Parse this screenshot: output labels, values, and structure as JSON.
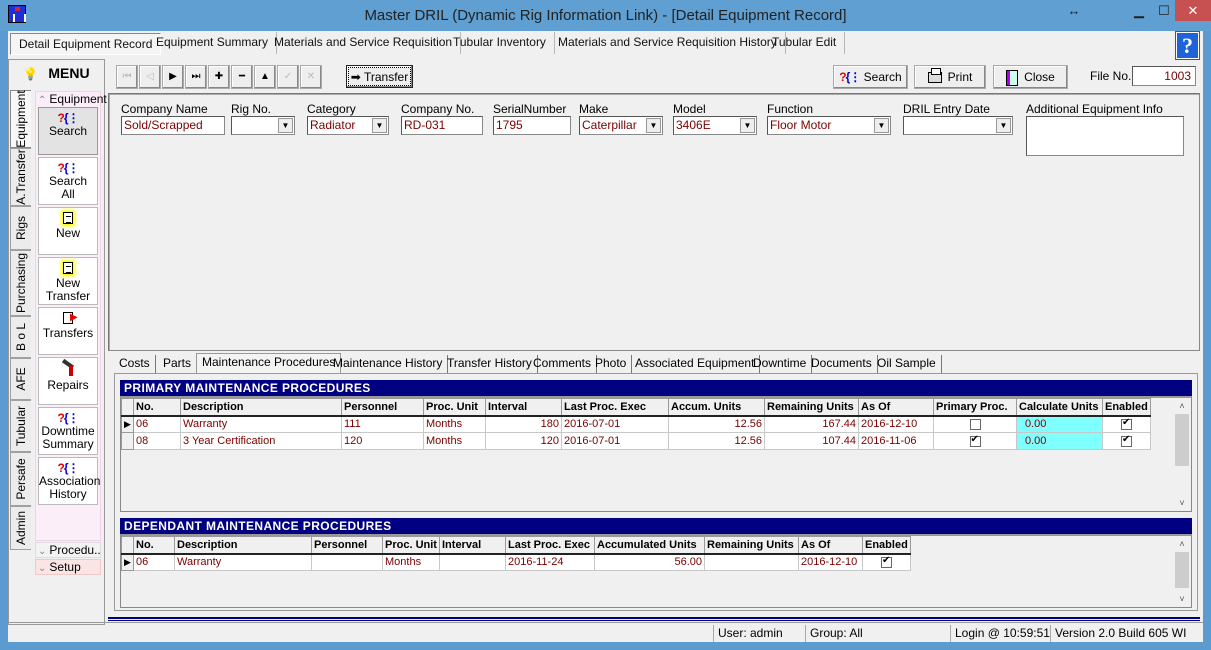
{
  "window": {
    "title": "Master DRIL (Dynamic Rig Information Link) - [Detail Equipment Record]",
    "resize_indicator": "↔",
    "minimize": "▁",
    "maximize": "☐",
    "close": "✕"
  },
  "main_tabs": [
    {
      "label": "Detail Equipment Record",
      "active": true
    },
    {
      "label": "Equipment Summary"
    },
    {
      "label": "Materials and Service Requisition"
    },
    {
      "label": "Tubular Inventory"
    },
    {
      "label": "Materials and Service Requisition History"
    },
    {
      "label": "Tubular Edit"
    }
  ],
  "help_label": "?",
  "menu": {
    "title": "MENU",
    "vertical_tabs": [
      "Equipment",
      "A.Transfer",
      "Rigs",
      "Purchasing",
      "B o L",
      "AFE",
      "Tubular",
      "Persafe",
      "Admin"
    ],
    "group_header": "Equipment",
    "items": [
      {
        "label_1": "Search",
        "label_2": "",
        "icon": "search-icon"
      },
      {
        "label_1": "Search",
        "label_2": "All",
        "icon": "search-icon"
      },
      {
        "label_1": "New",
        "label_2": "",
        "icon": "new-document-icon"
      },
      {
        "label_1": "New",
        "label_2": "Transfer",
        "icon": "new-document-icon"
      },
      {
        "label_1": "Transfers",
        "label_2": "",
        "icon": "transfer-document-icon"
      },
      {
        "label_1": "Repairs",
        "label_2": "",
        "icon": "repair-tools-icon"
      },
      {
        "label_1": "Downtime",
        "label_2": "Summary",
        "icon": "search-icon"
      },
      {
        "label_1": "Association",
        "label_2": "History",
        "icon": "search-icon"
      }
    ],
    "collapsed_groups": [
      "Procedu...",
      "Setup"
    ]
  },
  "toolbar": {
    "nav": {
      "first": "⏮",
      "prev": "◁",
      "next": "▶",
      "last": "⏭",
      "add": "✚",
      "delete": "━",
      "up": "▲",
      "confirm": "✓",
      "cancel": "✕"
    },
    "transfer_label": "Transfer",
    "transfer_icon": "➡",
    "search_label": "Search",
    "print_label": "Print",
    "close_label": "Close",
    "file_no_label": "File No.",
    "file_no_value": "1003"
  },
  "header_fields": [
    {
      "label": "Company Name",
      "value": "Sold/Scrapped",
      "dropdown": false
    },
    {
      "label": "Rig No.",
      "value": "",
      "dropdown": true
    },
    {
      "label": "Category",
      "value": "Radiator",
      "dropdown": true
    },
    {
      "label": "Company No.",
      "value": "RD-031",
      "dropdown": false
    },
    {
      "label": "SerialNumber",
      "value": "1795",
      "dropdown": false
    },
    {
      "label": "Make",
      "value": "Caterpillar",
      "dropdown": true
    },
    {
      "label": "Model",
      "value": "3406E",
      "dropdown": true
    },
    {
      "label": "Function",
      "value": "Floor Motor",
      "dropdown": true
    },
    {
      "label": "DRIL Entry Date",
      "value": "",
      "dropdown": true
    },
    {
      "label": "Additional Equipment Info",
      "value": ""
    }
  ],
  "sub_tabs": [
    "Costs",
    "Parts",
    "Maintenance Procedures",
    "Maintenance History",
    "Transfer History",
    "Comments",
    "Photo",
    "Associated Equipment",
    "Downtime",
    "Documents",
    "Oil Sample"
  ],
  "active_sub_tab": "Maintenance Procedures",
  "primary": {
    "title": "PRIMARY MAINTENANCE PROCEDURES",
    "columns": [
      "No.",
      "Description",
      "Personnel",
      "Proc. Unit",
      "Interval",
      "Last Proc. Exec",
      "Accum. Units",
      "Remaining Units",
      "As Of",
      "Primary  Proc.",
      "Calculate Units",
      "Enabled"
    ],
    "rows": [
      {
        "no": "06",
        "description": "Warranty",
        "personnel": "111",
        "proc_unit": "Months",
        "interval": "180",
        "last_exec": "2016-07-01",
        "accum": "12.56",
        "remaining": "167.44",
        "as_of": "2016-12-10",
        "primary": false,
        "calc": "0.00",
        "enabled": true,
        "current": true
      },
      {
        "no": "08",
        "description": "3 Year Certification",
        "personnel": "120",
        "proc_unit": "Months",
        "interval": "120",
        "last_exec": "2016-07-01",
        "accum": "12.56",
        "remaining": "107.44",
        "as_of": "2016-11-06",
        "primary": true,
        "calc": "0.00",
        "enabled": true,
        "current": false
      }
    ]
  },
  "dependant": {
    "title": "DEPENDANT MAINTENANCE PROCEDURES",
    "columns": [
      "No.",
      "Description",
      "Personnel",
      "Proc. Unit",
      "Interval",
      "Last Proc. Exec",
      "Accumulated Units",
      "Remaining Units",
      "As Of",
      "Enabled"
    ],
    "rows": [
      {
        "no": "06",
        "description": "Warranty",
        "personnel": "",
        "proc_unit": "Months",
        "interval": "",
        "last_exec": "2016-11-24",
        "accum": "56.00",
        "remaining": "",
        "as_of": "2016-12-10",
        "enabled": true,
        "current": true
      }
    ]
  },
  "status": {
    "user": "User: admin",
    "group": "Group: All",
    "login": "Login @ 10:59:51",
    "version": "Version 2.0 Build 605 WI"
  },
  "scroll_arrows": {
    "up": "˄",
    "down": "˅"
  },
  "row_indicator": "▶"
}
